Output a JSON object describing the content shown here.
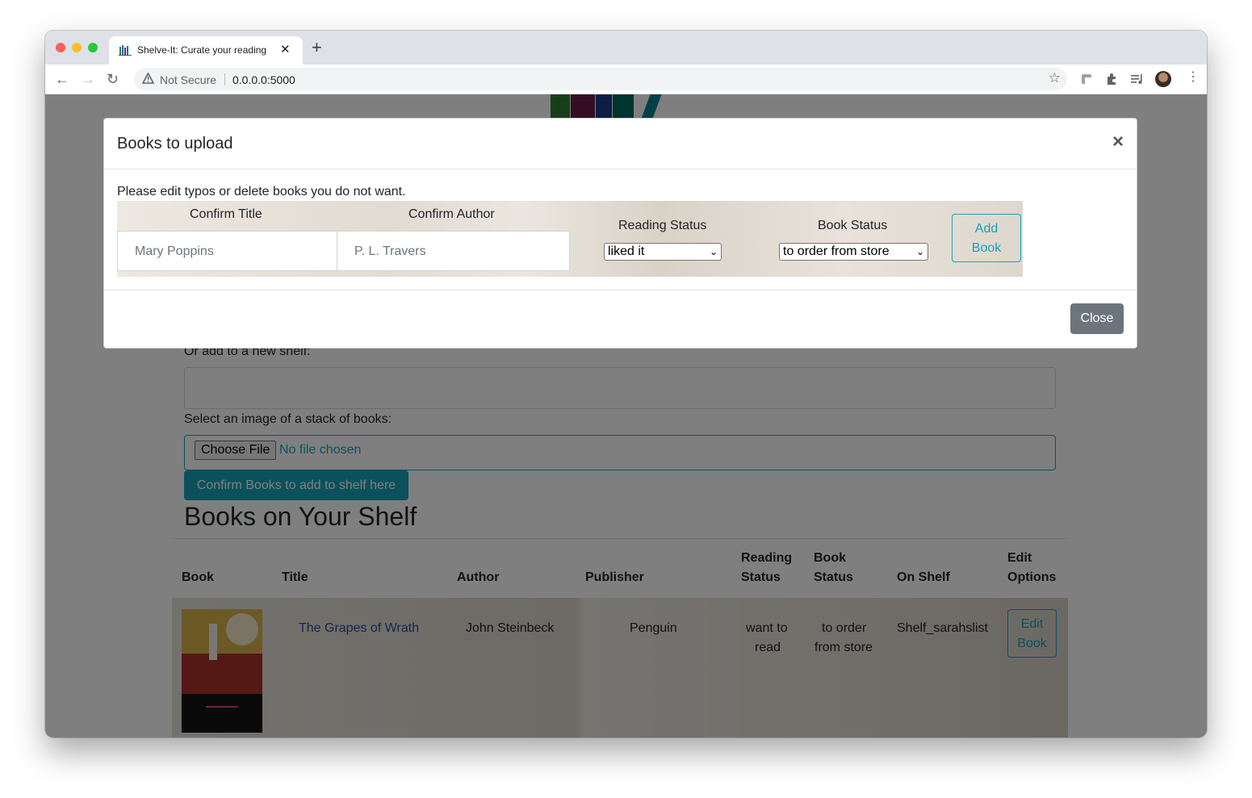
{
  "browser": {
    "tab_title": "Shelve-It: Curate your reading",
    "new_tab": "+",
    "tab_close": "✕",
    "not_secure": "Not Secure",
    "url": "0.0.0.0:5000"
  },
  "page": {
    "new_shelf_label": "Or add to a new shelf:",
    "image_label": "Select an image of a stack of books:",
    "choose_file": "Choose File",
    "no_file": "No file chosen",
    "confirm_button": "Confirm Books to add to shelf here",
    "shelf_heading": "Books on Your Shelf",
    "table": {
      "headers": {
        "book": "Book",
        "title": "Title",
        "author": "Author",
        "publisher": "Publisher",
        "reading_status_1": "Reading",
        "reading_status_2": "Status",
        "book_status_1": "Book",
        "book_status_2": "Status",
        "on_shelf": "On Shelf",
        "edit_1": "Edit",
        "edit_2": "Options"
      },
      "rows": [
        {
          "title": "The Grapes of Wrath",
          "author": "John Steinbeck",
          "publisher": "Penguin",
          "reading_status_1": "want to",
          "reading_status_2": "read",
          "book_status_1": "to order",
          "book_status_2": "from store",
          "on_shelf": "Shelf_sarahslist",
          "edit_1": "Edit",
          "edit_2": "Book"
        }
      ]
    }
  },
  "modal": {
    "title": "Books to upload",
    "close_x": "×",
    "message": "Please edit typos or delete books you do not want.",
    "labels": {
      "title": "Confirm Title",
      "author": "Confirm Author",
      "reading_status": "Reading Status",
      "book_status": "Book Status"
    },
    "title_value": "Mary Poppins",
    "author_value": "P. L. Travers",
    "reading_status_value": "liked it",
    "book_status_value": "to order from store",
    "add_1": "Add",
    "add_2": "Book",
    "close_button": "Close"
  }
}
